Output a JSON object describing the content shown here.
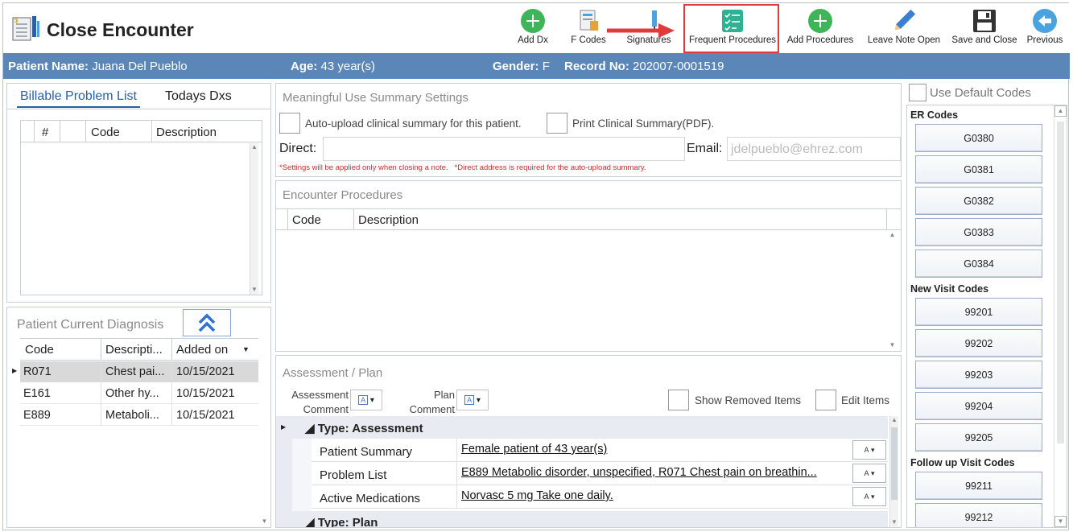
{
  "window": {
    "title": "Close Encounter"
  },
  "toolbar": {
    "add_dx": "Add Dx",
    "f_codes": "F Codes",
    "signatures": "Signatures",
    "frequent_procedures": "Frequent Procedures",
    "add_procedures": "Add Procedures",
    "leave_note_open": "Leave Note Open",
    "save_and_close": "Save and Close",
    "previous": "Previous"
  },
  "patient": {
    "name_label": "Patient Name:",
    "name": "Juana Del Pueblo",
    "age_label": "Age:",
    "age": "43 year(s)",
    "gender_label": "Gender:",
    "gender": "F",
    "record_label": "Record No:",
    "record": "202007-0001519"
  },
  "left": {
    "tabs": [
      "Billable Problem List",
      "Todays Dxs"
    ],
    "bpl_columns": [
      "#",
      "Code",
      "Description"
    ],
    "pcd_title": "Patient Current Diagnosis",
    "pcd_columns": [
      "Code",
      "Descripti...",
      "Added on"
    ],
    "pcd_rows": [
      {
        "code": "R071",
        "desc": "Chest pai...",
        "date": "10/15/2021"
      },
      {
        "code": "E161",
        "desc": "Other hy...",
        "date": "10/15/2021"
      },
      {
        "code": "E889",
        "desc": "Metaboli...",
        "date": "10/15/2021"
      }
    ]
  },
  "mu": {
    "title": "Meaningful Use Summary Settings",
    "auto_upload": "Auto-upload clinical summary for this patient.",
    "print_summary": "Print Clinical Summary(PDF).",
    "direct_label": "Direct:",
    "direct_value": "",
    "email_label": "Email:",
    "email_placeholder": "jdelpueblo@ehrez.com",
    "note": "*Settings will be applied only when closing a note.   *Direct address is required for the auto-upload summary."
  },
  "procedures": {
    "title": "Encounter Procedures",
    "columns": [
      "Code",
      "Description"
    ]
  },
  "ap": {
    "title": "Assessment / Plan",
    "assessment_comment": "Assessment Comment",
    "plan_comment": "Plan Comment",
    "show_removed": "Show Removed Items",
    "edit_items": "Edit Items",
    "group1": "Type: Assessment",
    "rows": [
      {
        "label": "Patient Summary",
        "value": "Female patient of 43 year(s)"
      },
      {
        "label": "Problem List",
        "value": "E889 Metabolic disorder, unspecified, R071 Chest pain on breathin..."
      },
      {
        "label": "Active Medications",
        "value": "Norvasc 5 mg Take one daily. "
      }
    ],
    "group2": "Type: Plan"
  },
  "codes": {
    "use_default": "Use Default Codes",
    "er_title": "ER Codes",
    "er": [
      "G0380",
      "G0381",
      "G0382",
      "G0383",
      "G0384"
    ],
    "new_title": "New Visit Codes",
    "new": [
      "99201",
      "99202",
      "99203",
      "99204",
      "99205"
    ],
    "follow_title": "Follow up Visit Codes",
    "follow": [
      "99211",
      "99212"
    ]
  },
  "colors": {
    "accent": "#5b86b8",
    "highlight": "#e03b3b",
    "green": "#3fb55a",
    "tab": "#2a5fa8"
  }
}
